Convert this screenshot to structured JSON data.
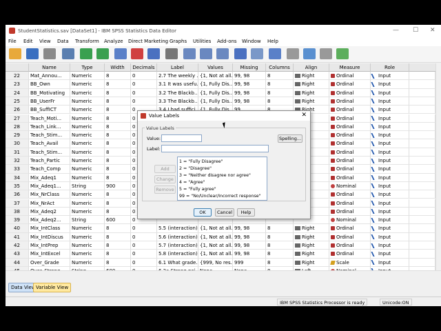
{
  "window": {
    "title": "StudentStatistics.sav [DataSet1] - IBM SPSS Statistics Data Editor"
  },
  "menu": [
    "File",
    "Edit",
    "View",
    "Data",
    "Transform",
    "Analyze",
    "Direct Marketing",
    "Graphs",
    "Utilities",
    "Add-ons",
    "Window",
    "Help"
  ],
  "columns": [
    "Name",
    "Type",
    "Width",
    "Decimals",
    "Label",
    "Values",
    "Missing",
    "Columns",
    "Align",
    "Measure",
    "Role"
  ],
  "rows": [
    {
      "n": "22",
      "name": "Mat_Annou...",
      "type": "Numeric",
      "width": "8",
      "dec": "0",
      "label": "2.7 The weekly ...",
      "values": "{1, Not at all...",
      "missing": "99, 98",
      "cols": "8",
      "align": "Right",
      "measure": "Ordinal",
      "role": "Input"
    },
    {
      "n": "23",
      "name": "BB_Own",
      "type": "Numeric",
      "width": "8",
      "dec": "0",
      "label": "3.1 It was usefu...",
      "values": "{1, Fully Dis...",
      "missing": "99, 98",
      "cols": "8",
      "align": "Right",
      "measure": "Ordinal",
      "role": "Input"
    },
    {
      "n": "24",
      "name": "BB_Motivating",
      "type": "Numeric",
      "width": "8",
      "dec": "0",
      "label": "3.2 The Blackb...",
      "values": "{1, Fully Dis...",
      "missing": "99, 98",
      "cols": "8",
      "align": "Right",
      "measure": "Ordinal",
      "role": "Input"
    },
    {
      "n": "25",
      "name": "BB_UserFr",
      "type": "Numeric",
      "width": "8",
      "dec": "0",
      "label": "3.3 The Blackb...",
      "values": "{1, Fully Dis...",
      "missing": "99, 98",
      "cols": "8",
      "align": "Right",
      "measure": "Ordinal",
      "role": "Input"
    },
    {
      "n": "26",
      "name": "BB_SuffICT",
      "type": "Numeric",
      "width": "8",
      "dec": "0",
      "label": "3.4 I had suffici...",
      "values": "{1, Fully Dis...",
      "missing": "99",
      "cols": "8",
      "align": "Right",
      "measure": "Ordinal",
      "role": "Input"
    },
    {
      "n": "27",
      "name": "Teach_Moti...",
      "type": "Numeric",
      "width": "8",
      "dec": "0",
      "label": "",
      "values": "",
      "missing": "",
      "cols": "",
      "align": "",
      "measure": "Ordinal",
      "role": "Input"
    },
    {
      "n": "28",
      "name": "Teach_Link...",
      "type": "Numeric",
      "width": "8",
      "dec": "0",
      "label": "",
      "values": "",
      "missing": "",
      "cols": "",
      "align": "",
      "measure": "Ordinal",
      "role": "Input"
    },
    {
      "n": "29",
      "name": "Teach_Stim...",
      "type": "Numeric",
      "width": "8",
      "dec": "0",
      "label": "",
      "values": "",
      "missing": "",
      "cols": "",
      "align": "",
      "measure": "Ordinal",
      "role": "Input"
    },
    {
      "n": "30",
      "name": "Teach_Avail",
      "type": "Numeric",
      "width": "8",
      "dec": "0",
      "label": "",
      "values": "",
      "missing": "",
      "cols": "",
      "align": "",
      "measure": "Ordinal",
      "role": "Input"
    },
    {
      "n": "31",
      "name": "Teach_Stim...",
      "type": "Numeric",
      "width": "8",
      "dec": "0",
      "label": "",
      "values": "",
      "missing": "",
      "cols": "",
      "align": "",
      "measure": "Ordinal",
      "role": "Input"
    },
    {
      "n": "32",
      "name": "Teach_Partic",
      "type": "Numeric",
      "width": "8",
      "dec": "0",
      "label": "",
      "values": "",
      "missing": "",
      "cols": "",
      "align": "",
      "measure": "Ordinal",
      "role": "Input"
    },
    {
      "n": "33",
      "name": "Teach_Comp",
      "type": "Numeric",
      "width": "8",
      "dec": "0",
      "label": "",
      "values": "",
      "missing": "",
      "cols": "",
      "align": "",
      "measure": "Ordinal",
      "role": "Input"
    },
    {
      "n": "34",
      "name": "Mix_Adeq1",
      "type": "Numeric",
      "width": "8",
      "dec": "0",
      "label": "",
      "values": "",
      "missing": "",
      "cols": "",
      "align": "",
      "measure": "Ordinal",
      "role": "Input"
    },
    {
      "n": "35",
      "name": "Mix_Adeq1...",
      "type": "String",
      "width": "900",
      "dec": "0",
      "label": "",
      "values": "",
      "missing": "",
      "cols": "",
      "align": "",
      "measure": "Nominal",
      "role": "Input"
    },
    {
      "n": "36",
      "name": "Mix_NrClass",
      "type": "Numeric",
      "width": "8",
      "dec": "0",
      "label": "",
      "values": "",
      "missing": "",
      "cols": "",
      "align": "",
      "measure": "Ordinal",
      "role": "Input"
    },
    {
      "n": "37",
      "name": "Mix_NrAct",
      "type": "Numeric",
      "width": "8",
      "dec": "0",
      "label": "",
      "values": "",
      "missing": "",
      "cols": "",
      "align": "",
      "measure": "Ordinal",
      "role": "Input"
    },
    {
      "n": "38",
      "name": "Mix_Adeq2",
      "type": "Numeric",
      "width": "8",
      "dec": "0",
      "label": "",
      "values": "",
      "missing": "",
      "cols": "",
      "align": "",
      "measure": "Ordinal",
      "role": "Input"
    },
    {
      "n": "39",
      "name": "Mix_Adeq2...",
      "type": "String",
      "width": "600",
      "dec": "0",
      "label": "",
      "values": "",
      "missing": "",
      "cols": "",
      "align": "",
      "measure": "Nominal",
      "role": "Input"
    },
    {
      "n": "40",
      "name": "Mix_IntClass",
      "type": "Numeric",
      "width": "8",
      "dec": "0",
      "label": "5.5 (interaction)...",
      "values": "{1, Not at all...",
      "missing": "99, 98",
      "cols": "8",
      "align": "Right",
      "measure": "Ordinal",
      "role": "Input"
    },
    {
      "n": "41",
      "name": "Mix_IntDiscus",
      "type": "Numeric",
      "width": "8",
      "dec": "0",
      "label": "5.6 (interaction)...",
      "values": "{1, Not at all...",
      "missing": "99, 98",
      "cols": "8",
      "align": "Right",
      "measure": "Ordinal",
      "role": "Input"
    },
    {
      "n": "42",
      "name": "Mix_IntPrep",
      "type": "Numeric",
      "width": "8",
      "dec": "0",
      "label": "5.7 (interaction)...",
      "values": "{1, Not at all...",
      "missing": "99, 98",
      "cols": "8",
      "align": "Right",
      "measure": "Ordinal",
      "role": "Input"
    },
    {
      "n": "43",
      "name": "Mix_IntExcel",
      "type": "Numeric",
      "width": "8",
      "dec": "0",
      "label": "5.8 (interaction)...",
      "values": "{1, Not at all...",
      "missing": "99, 98",
      "cols": "8",
      "align": "Right",
      "measure": "Ordinal",
      "role": "Input"
    },
    {
      "n": "44",
      "name": "Over_Grade",
      "type": "Numeric",
      "width": "8",
      "dec": "0",
      "label": "6.1 What grade...",
      "values": "{999, No res...",
      "missing": "999",
      "cols": "8",
      "align": "Right",
      "measure": "Scale",
      "role": "Input"
    },
    {
      "n": "45",
      "name": "Over_Strong",
      "type": "String",
      "width": "600",
      "dec": "0",
      "label": "6.2a Strong poi...",
      "values": "None",
      "missing": "None",
      "cols": "8",
      "align": "Left",
      "measure": "Nominal",
      "role": "Input"
    }
  ],
  "tabs": {
    "data_view": "Data View",
    "variable_view": "Variable View"
  },
  "status": {
    "processor": "IBM SPSS Statistics Processor is ready",
    "unicode": "Unicode:ON"
  },
  "dialog": {
    "title": "Value Labels",
    "group_label": "Value Labels",
    "value_label": "Value:",
    "label_label": "Label:",
    "spelling": "Spelling...",
    "add": "Add",
    "change": "Change",
    "remove": "Remove",
    "items": [
      "1 = \"Fully Disagree\"",
      "2 = \"Disagree\"",
      "3 = \"Neither disagree nor agree\"",
      "4 = \"Agree\"",
      "5 = \"Fully agree\"",
      "99 = \"No/Unclear/Incorrect response\""
    ],
    "ok": "OK",
    "cancel": "Cancel",
    "help": "Help"
  }
}
